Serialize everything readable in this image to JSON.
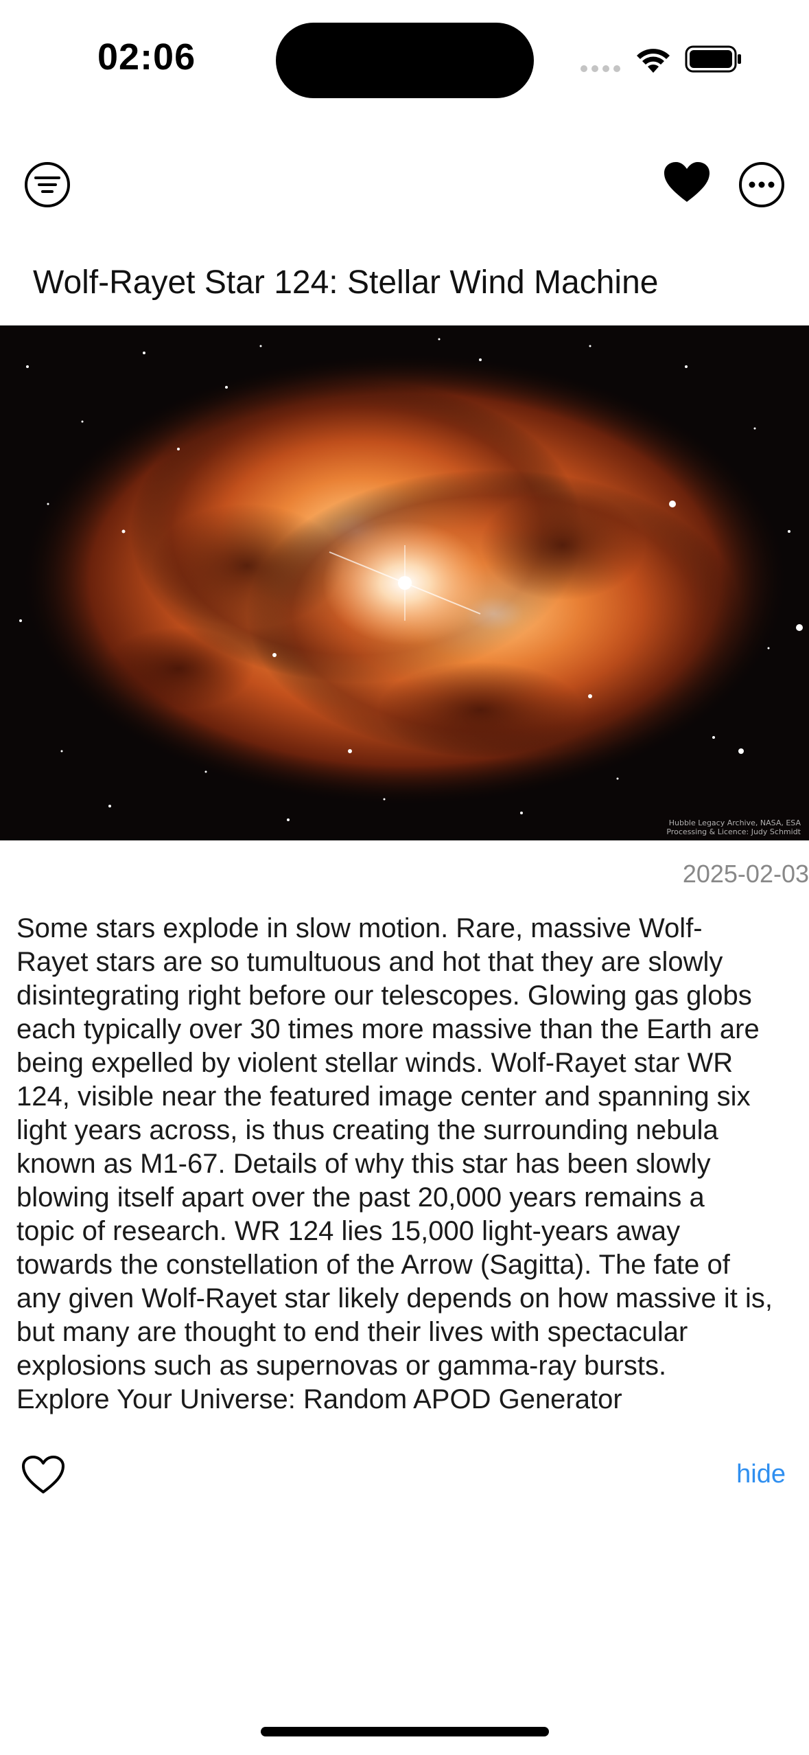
{
  "status_bar": {
    "time": "02:06"
  },
  "toolbar": {
    "filter_icon": "filter-icon",
    "favorite_icon": "heart-filled-icon",
    "more_icon": "ellipsis-circle-icon"
  },
  "apod": {
    "title": "Wolf-Rayet Star 124: Stellar Wind Machine",
    "image_credit_line1": "Hubble Legacy Archive, NASA, ESA",
    "image_credit_line2": "Processing & Licence: Judy Schmidt",
    "date": "2025-02-03",
    "explanation": "Some stars explode in slow motion.  Rare, massive Wolf-\nRayet stars are so tumultuous and hot that they are slowly\ndisintegrating right before our telescopes.  Glowing gas globs\neach typically over 30 times more massive than the Earth are\nbeing expelled by violent stellar winds.  Wolf-Rayet star WR\n124, visible near the featured image center and spanning six\nlight years across, is thus creating the surrounding nebula\nknown as M1-67.  Details of why this star has been slowly\nblowing itself apart over the past 20,000 years remains a\ntopic of research.  WR 124 lies 15,000 light-years away\ntowards the constellation of the Arrow (Sagitta).  The fate of\nany given Wolf-Rayet star likely depends on how massive it is,\nbut many are thought to end their lives with spectacular\nexplosions such as supernovas or gamma-ray bursts.\nExplore Your Universe: Random APOD Generator"
  },
  "actions": {
    "favorite_icon": "heart-outline-icon",
    "hide_label": "hide"
  },
  "colors": {
    "link": "#2f8ff0",
    "date": "#888888",
    "nebula_core": "#ffd9a0",
    "nebula_mid": "#e0702a",
    "nebula_outer": "#8a2d10",
    "space": "#0a0606"
  }
}
